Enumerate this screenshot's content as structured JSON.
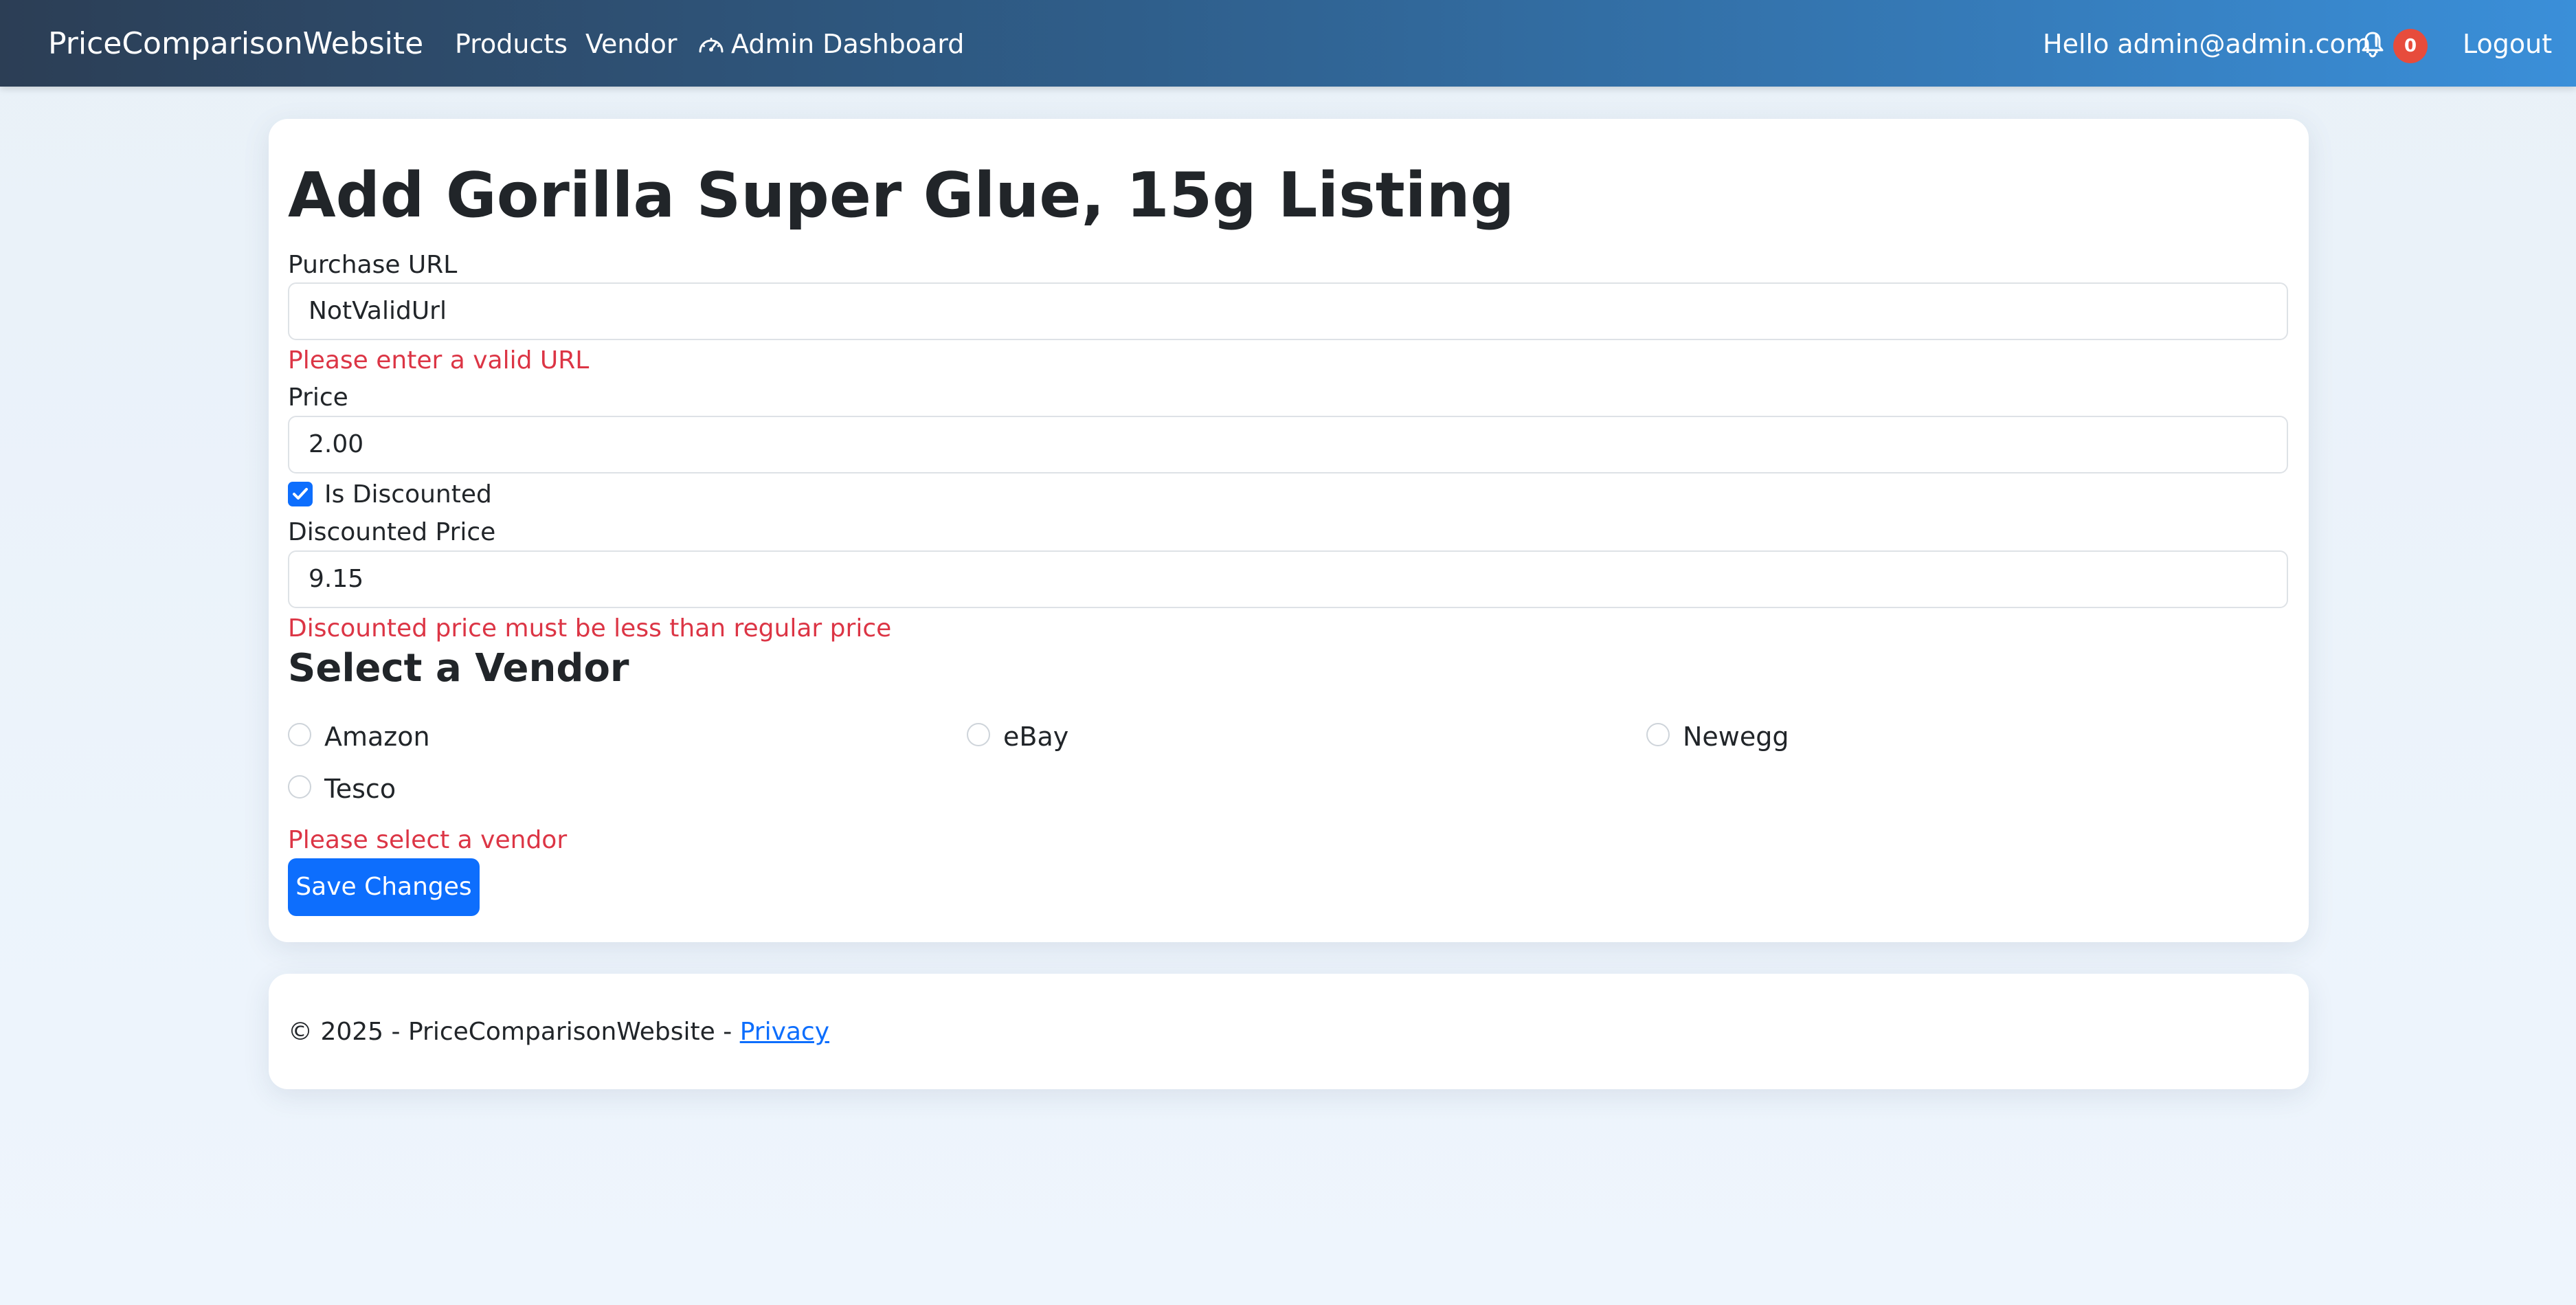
{
  "navbar": {
    "brand": "PriceComparisonWebsite",
    "links": {
      "products": "Products",
      "vendor": "Vendor",
      "admin_dashboard": "Admin Dashboard"
    },
    "greeting": "Hello admin@admin.com!",
    "notification_count": "0",
    "logout": "Logout",
    "icons": {
      "admin_dashboard": "speedometer-icon",
      "notifications": "bell-icon"
    }
  },
  "form": {
    "title": "Add Gorilla Super Glue, 15g Listing",
    "purchase_url": {
      "label": "Purchase URL",
      "value": "NotValidUrl",
      "error": "Please enter a valid URL"
    },
    "price": {
      "label": "Price",
      "value": "2.00"
    },
    "is_discounted": {
      "label": "Is Discounted",
      "checked": true
    },
    "discounted_price": {
      "label": "Discounted Price",
      "value": "9.15",
      "error": "Discounted price must be less than regular price"
    },
    "vendor_section": {
      "title": "Select a Vendor",
      "options": [
        "Amazon",
        "eBay",
        "Newegg",
        "Tesco"
      ],
      "selected": null,
      "error": "Please select a vendor"
    },
    "save_button": "Save Changes"
  },
  "footer": {
    "text": "© 2025 - PriceComparisonWebsite - ",
    "privacy_link": "Privacy"
  },
  "colors": {
    "primary": "#0d6efd",
    "error": "#dc3545",
    "badge": "#e74c3c",
    "nav_gradient_start": "#2c3e55",
    "nav_gradient_end": "#3a8fd9"
  }
}
